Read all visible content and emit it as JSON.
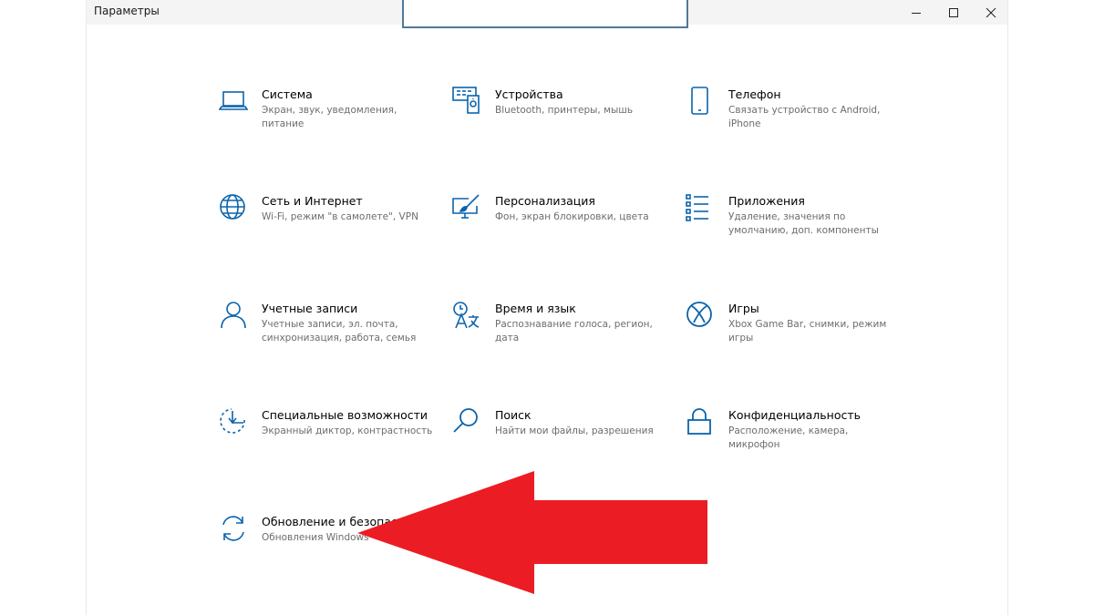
{
  "window": {
    "title": "Параметры"
  },
  "accent_color": "#0a64ad",
  "annotation_color": "#ec1c24",
  "tiles": [
    {
      "key": "system",
      "icon": "laptop-icon",
      "name": "Система",
      "desc": "Экран, звук, уведомления, питание"
    },
    {
      "key": "devices",
      "icon": "devices-icon",
      "name": "Устройства",
      "desc": "Bluetooth, принтеры, мышь"
    },
    {
      "key": "phone",
      "icon": "phone-icon",
      "name": "Телефон",
      "desc": "Связать устройство с Android, iPhone"
    },
    {
      "key": "network",
      "icon": "globe-icon",
      "name": "Сеть и Интернет",
      "desc": "Wi-Fi, режим \"в самолете\", VPN"
    },
    {
      "key": "personalization",
      "icon": "paint-brush-icon",
      "name": "Персонализация",
      "desc": "Фон, экран блокировки, цвета"
    },
    {
      "key": "apps",
      "icon": "apps-list-icon",
      "name": "Приложения",
      "desc": "Удаление, значения по умолчанию, доп. компоненты"
    },
    {
      "key": "accounts",
      "icon": "person-icon",
      "name": "Учетные записи",
      "desc": "Учетные записи, эл. почта, синхронизация, работа, семья"
    },
    {
      "key": "time-language",
      "icon": "time-language-icon",
      "name": "Время и язык",
      "desc": "Распознавание голоса, регион, дата"
    },
    {
      "key": "gaming",
      "icon": "xbox-icon",
      "name": "Игры",
      "desc": "Xbox Game Bar, снимки, режим игры"
    },
    {
      "key": "ease-of-access",
      "icon": "ease-of-access-icon",
      "name": "Специальные возможности",
      "desc": "Экранный диктор, контрастность"
    },
    {
      "key": "search",
      "icon": "search-icon",
      "name": "Поиск",
      "desc": "Найти мои файлы, разрешения"
    },
    {
      "key": "privacy",
      "icon": "lock-icon",
      "name": "Конфиденциальность",
      "desc": "Расположение, камера, микрофон"
    },
    {
      "key": "update-security",
      "icon": "sync-icon",
      "name": "Обновление и безопасность",
      "desc": "Обновления Windows"
    }
  ]
}
